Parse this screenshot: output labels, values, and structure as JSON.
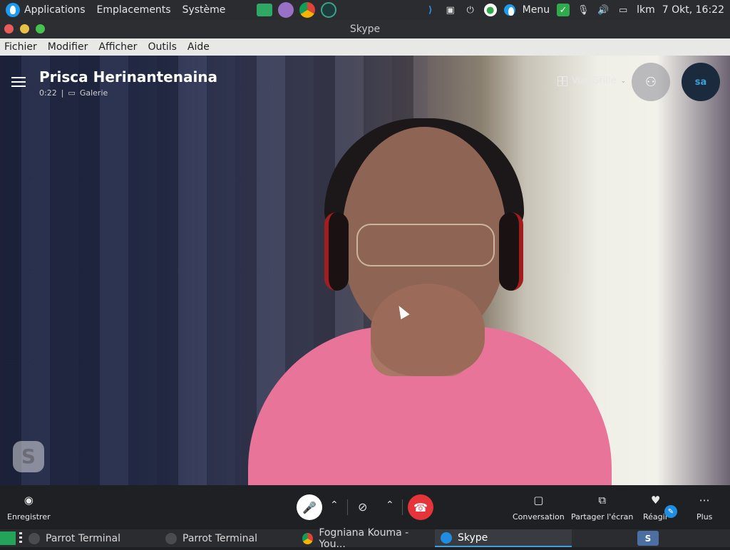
{
  "top_panel": {
    "menus": [
      "Applications",
      "Emplacements",
      "Système"
    ],
    "menu_label": "Menu",
    "user": "lkm",
    "datetime": "7 Okt, 16:22"
  },
  "window": {
    "title": "Skype"
  },
  "menubar": [
    "Fichier",
    "Modifier",
    "Afficher",
    "Outils",
    "Aide"
  ],
  "call": {
    "contact_name": "Prisca Herinantenaina",
    "duration": "0:22",
    "separator": "|",
    "view_mode_small": "Galerie",
    "grid_button": "Vue Grille",
    "self_initials": "sa"
  },
  "controls": {
    "record": "Enregistrer",
    "conversation": "Conversation",
    "share_screen": "Partager l'écran",
    "react": "Réagir",
    "more": "Plus"
  },
  "taskbar": {
    "items": [
      "Parrot Terminal",
      "Parrot Terminal",
      "Fogniana Kouma - You...",
      "Skype"
    ]
  },
  "colors": {
    "hangup": "#e5343a",
    "accent": "#1f8ee0",
    "shirt": "#e8749a"
  }
}
